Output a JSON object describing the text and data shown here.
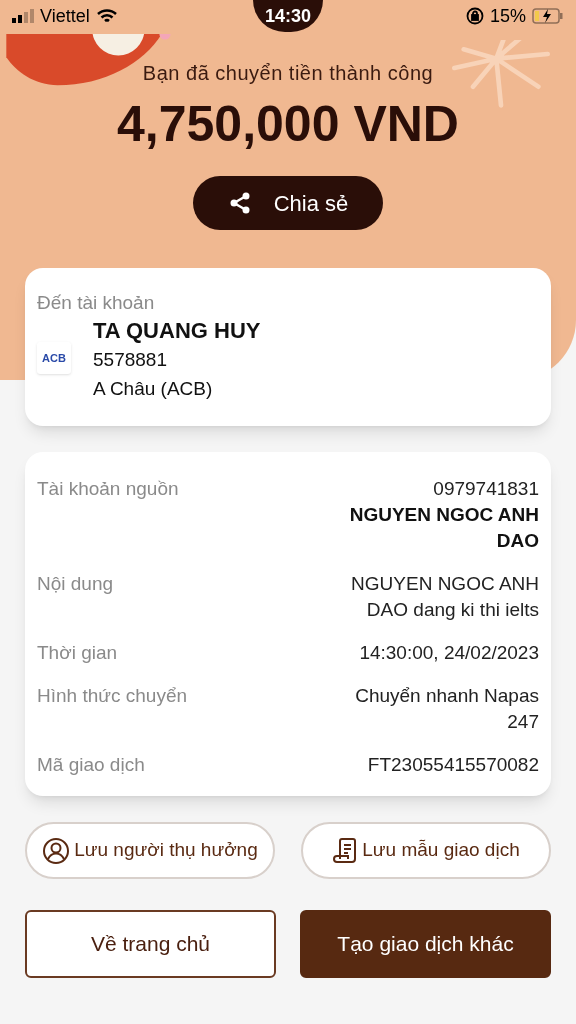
{
  "status_bar": {
    "carrier": "Viettel",
    "time": "14:30",
    "battery": "15%"
  },
  "header": {
    "message": "Bạn đã chuyển tiền thành công",
    "amount": "4,750,000 VND",
    "share_label": "Chia sẻ"
  },
  "recipient": {
    "label": "Đến tài khoản",
    "name": "TA QUANG HUY",
    "account": "5578881",
    "bank": "A Châu (ACB)",
    "bank_logo": "ACB"
  },
  "details": [
    {
      "label": "Tài khoản nguồn",
      "values": [
        {
          "text": "0979741831",
          "bold": false
        },
        {
          "text": "NGUYEN NGOC ANH DAO",
          "bold": true
        }
      ]
    },
    {
      "label": "Nội dung",
      "values": [
        {
          "text": "NGUYEN NGOC ANH DAO dang ki thi ielts",
          "bold": false
        }
      ]
    },
    {
      "label": "Thời gian",
      "values": [
        {
          "text": "14:30:00, 24/02/2023",
          "bold": false
        }
      ]
    },
    {
      "label": "Hình thức chuyển",
      "values": [
        {
          "text": "Chuyển nhanh Napas 247",
          "bold": false
        }
      ]
    },
    {
      "label": "Mã giao dịch",
      "values": [
        {
          "text": "FT23055415570082",
          "bold": false
        }
      ]
    }
  ],
  "save_actions": [
    {
      "kind": "person",
      "label": "Lưu người thụ hưởng"
    },
    {
      "kind": "receipt",
      "label": "Lưu mẫu giao dịch"
    }
  ],
  "buttons": [
    {
      "kind": "outline",
      "label": "Về trang chủ"
    },
    {
      "kind": "filled",
      "label": "Tạo giao dịch khác"
    }
  ]
}
